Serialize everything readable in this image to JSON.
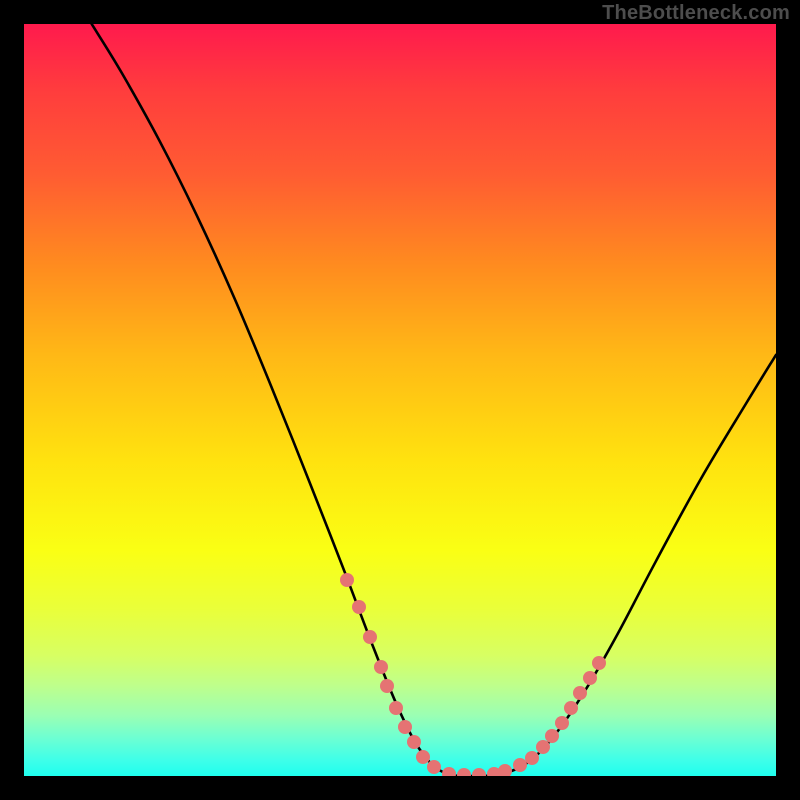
{
  "watermark": "TheBottleneck.com",
  "chart_data": {
    "type": "line",
    "title": "",
    "xlabel": "",
    "ylabel": "",
    "xlim": [
      0,
      100
    ],
    "ylim": [
      0,
      100
    ],
    "curve": [
      {
        "x": 9.0,
        "y": 100.0
      },
      {
        "x": 13.0,
        "y": 93.5
      },
      {
        "x": 18.0,
        "y": 84.5
      },
      {
        "x": 23.0,
        "y": 74.5
      },
      {
        "x": 28.0,
        "y": 63.5
      },
      {
        "x": 33.0,
        "y": 51.5
      },
      {
        "x": 38.0,
        "y": 39.0
      },
      {
        "x": 42.5,
        "y": 27.5
      },
      {
        "x": 46.5,
        "y": 17.0
      },
      {
        "x": 50.0,
        "y": 8.5
      },
      {
        "x": 53.0,
        "y": 3.0
      },
      {
        "x": 56.0,
        "y": 0.4
      },
      {
        "x": 60.0,
        "y": 0.0
      },
      {
        "x": 64.0,
        "y": 0.4
      },
      {
        "x": 67.5,
        "y": 2.2
      },
      {
        "x": 71.0,
        "y": 6.0
      },
      {
        "x": 75.0,
        "y": 12.0
      },
      {
        "x": 79.0,
        "y": 19.0
      },
      {
        "x": 84.0,
        "y": 28.5
      },
      {
        "x": 90.0,
        "y": 39.5
      },
      {
        "x": 96.0,
        "y": 49.5
      },
      {
        "x": 100.0,
        "y": 56.0
      }
    ],
    "dots": [
      {
        "x": 43.0,
        "y": 26.0
      },
      {
        "x": 44.5,
        "y": 22.5
      },
      {
        "x": 46.0,
        "y": 18.5
      },
      {
        "x": 47.5,
        "y": 14.5
      },
      {
        "x": 48.3,
        "y": 12.0
      },
      {
        "x": 49.5,
        "y": 9.0
      },
      {
        "x": 50.7,
        "y": 6.5
      },
      {
        "x": 51.8,
        "y": 4.5
      },
      {
        "x": 53.0,
        "y": 2.5
      },
      {
        "x": 54.5,
        "y": 1.2
      },
      {
        "x": 56.5,
        "y": 0.3
      },
      {
        "x": 58.5,
        "y": 0.1
      },
      {
        "x": 60.5,
        "y": 0.1
      },
      {
        "x": 62.5,
        "y": 0.3
      },
      {
        "x": 64.0,
        "y": 0.6
      },
      {
        "x": 66.0,
        "y": 1.4
      },
      {
        "x": 67.5,
        "y": 2.4
      },
      {
        "x": 69.0,
        "y": 3.8
      },
      {
        "x": 70.2,
        "y": 5.3
      },
      {
        "x": 71.5,
        "y": 7.0
      },
      {
        "x": 72.7,
        "y": 9.0
      },
      {
        "x": 74.0,
        "y": 11.0
      },
      {
        "x": 75.3,
        "y": 13.0
      },
      {
        "x": 76.5,
        "y": 15.0
      }
    ]
  }
}
